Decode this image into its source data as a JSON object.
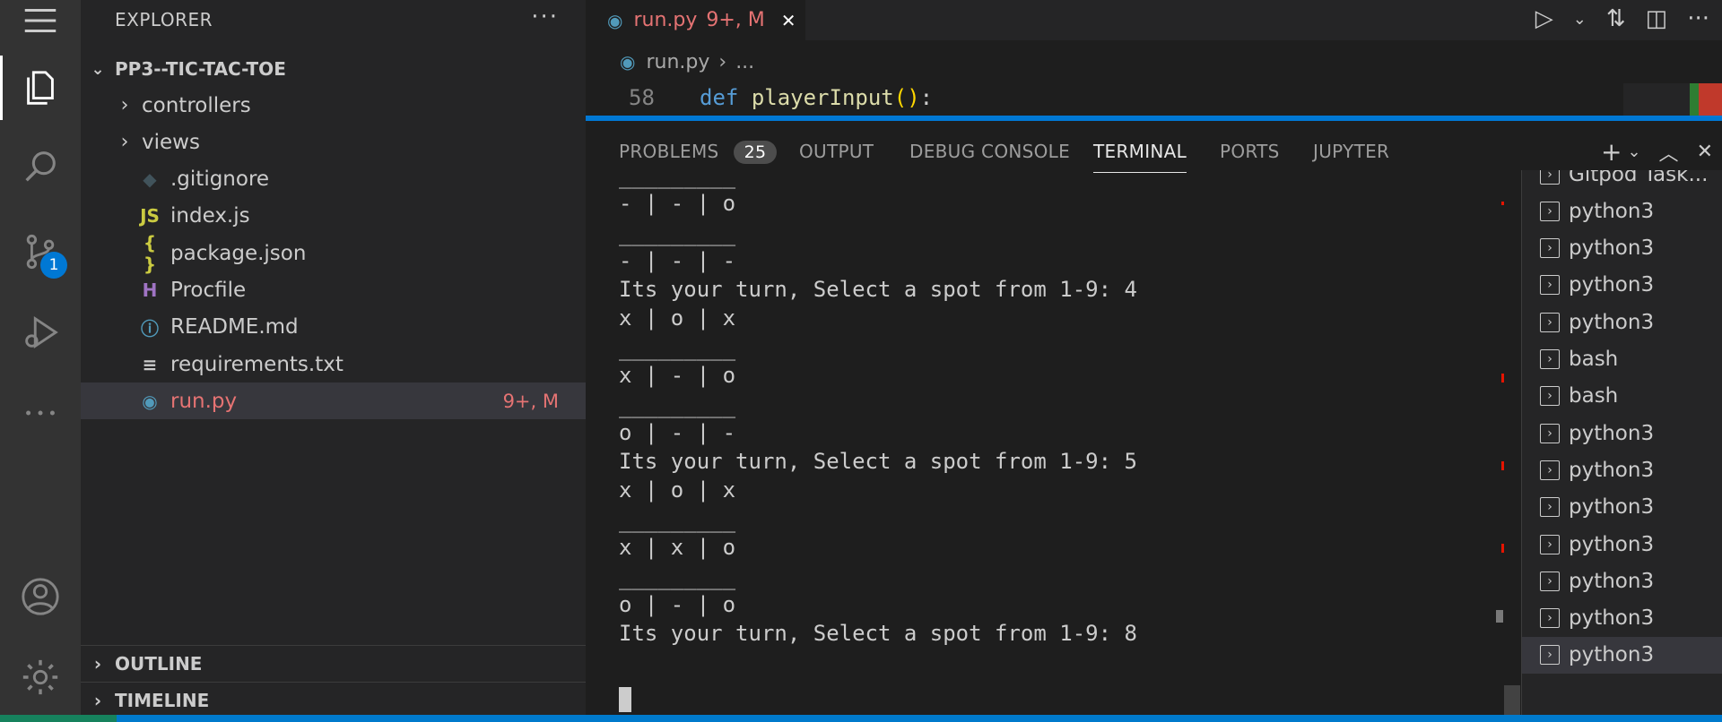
{
  "sidebar": {
    "header": "EXPLORER",
    "more": "···",
    "folder": "PP3--TIC-TAC-TOE",
    "items": [
      {
        "label": "controllers",
        "chevron": "›",
        "icon": "",
        "icon_color": "#cccccc",
        "decor": ""
      },
      {
        "label": "views",
        "chevron": "›",
        "icon": "",
        "icon_color": "#cccccc",
        "decor": ""
      },
      {
        "label": ".gitignore",
        "chevron": "",
        "icon": "◆",
        "icon_color": "#41535b",
        "decor": ""
      },
      {
        "label": "index.js",
        "chevron": "",
        "icon": "JS",
        "icon_color": "#cbcb41",
        "decor": ""
      },
      {
        "label": "package.json",
        "chevron": "",
        "icon": "{ }",
        "icon_color": "#cbcb41",
        "decor": ""
      },
      {
        "label": "Procfile",
        "chevron": "",
        "icon": "H",
        "icon_color": "#a074c4",
        "decor": ""
      },
      {
        "label": "README.md",
        "chevron": "",
        "icon": "ⓘ",
        "icon_color": "#519aba",
        "decor": ""
      },
      {
        "label": "requirements.txt",
        "chevron": "",
        "icon": "≡",
        "icon_color": "#cccccc",
        "decor": ""
      },
      {
        "label": "run.py",
        "chevron": "",
        "icon": "◉",
        "icon_color": "#519aba",
        "decor": "9+, M"
      }
    ],
    "sections": [
      "OUTLINE",
      "TIMELINE"
    ]
  },
  "activity": {
    "scm_badge": "1"
  },
  "editor": {
    "tab_label": "run.py",
    "tab_decor": "9+, M",
    "tab_close": "✕",
    "breadcrumb_file": "run.py",
    "breadcrumb_rest": "...",
    "line_number": "58",
    "code_keyword": "def",
    "code_fn": "playerInput",
    "code_paren": "()",
    "code_colon": ":"
  },
  "panel": {
    "tabs": [
      "PROBLEMS",
      "OUTPUT",
      "DEBUG CONSOLE",
      "TERMINAL",
      "PORTS",
      "JUPYTER"
    ],
    "problems_count": "25",
    "active_tab": "TERMINAL"
  },
  "terminal": {
    "lines": [
      "_________",
      "- | - | o",
      "_________",
      "- | - | -",
      "Its your turn, Select a spot from 1-9: 4",
      "x | o | x",
      "_________",
      "x | - | o",
      "_________",
      "o | - | -",
      "Its your turn, Select a spot from 1-9: 5",
      "x | o | x",
      "_________",
      "x | x | o",
      "_________",
      "o | - | o",
      "Its your turn, Select a spot from 1-9: 8"
    ]
  },
  "terminal_list": [
    "Gitpod Task...",
    "python3",
    "python3",
    "python3",
    "python3",
    "bash",
    "bash",
    "python3",
    "python3",
    "python3",
    "python3",
    "python3",
    "python3",
    "python3"
  ],
  "colors": {
    "accent": "#0078d4",
    "modified": "#e57373",
    "keyword": "#569cd6",
    "function": "#dcdcaa",
    "paren": "#ffd700"
  }
}
